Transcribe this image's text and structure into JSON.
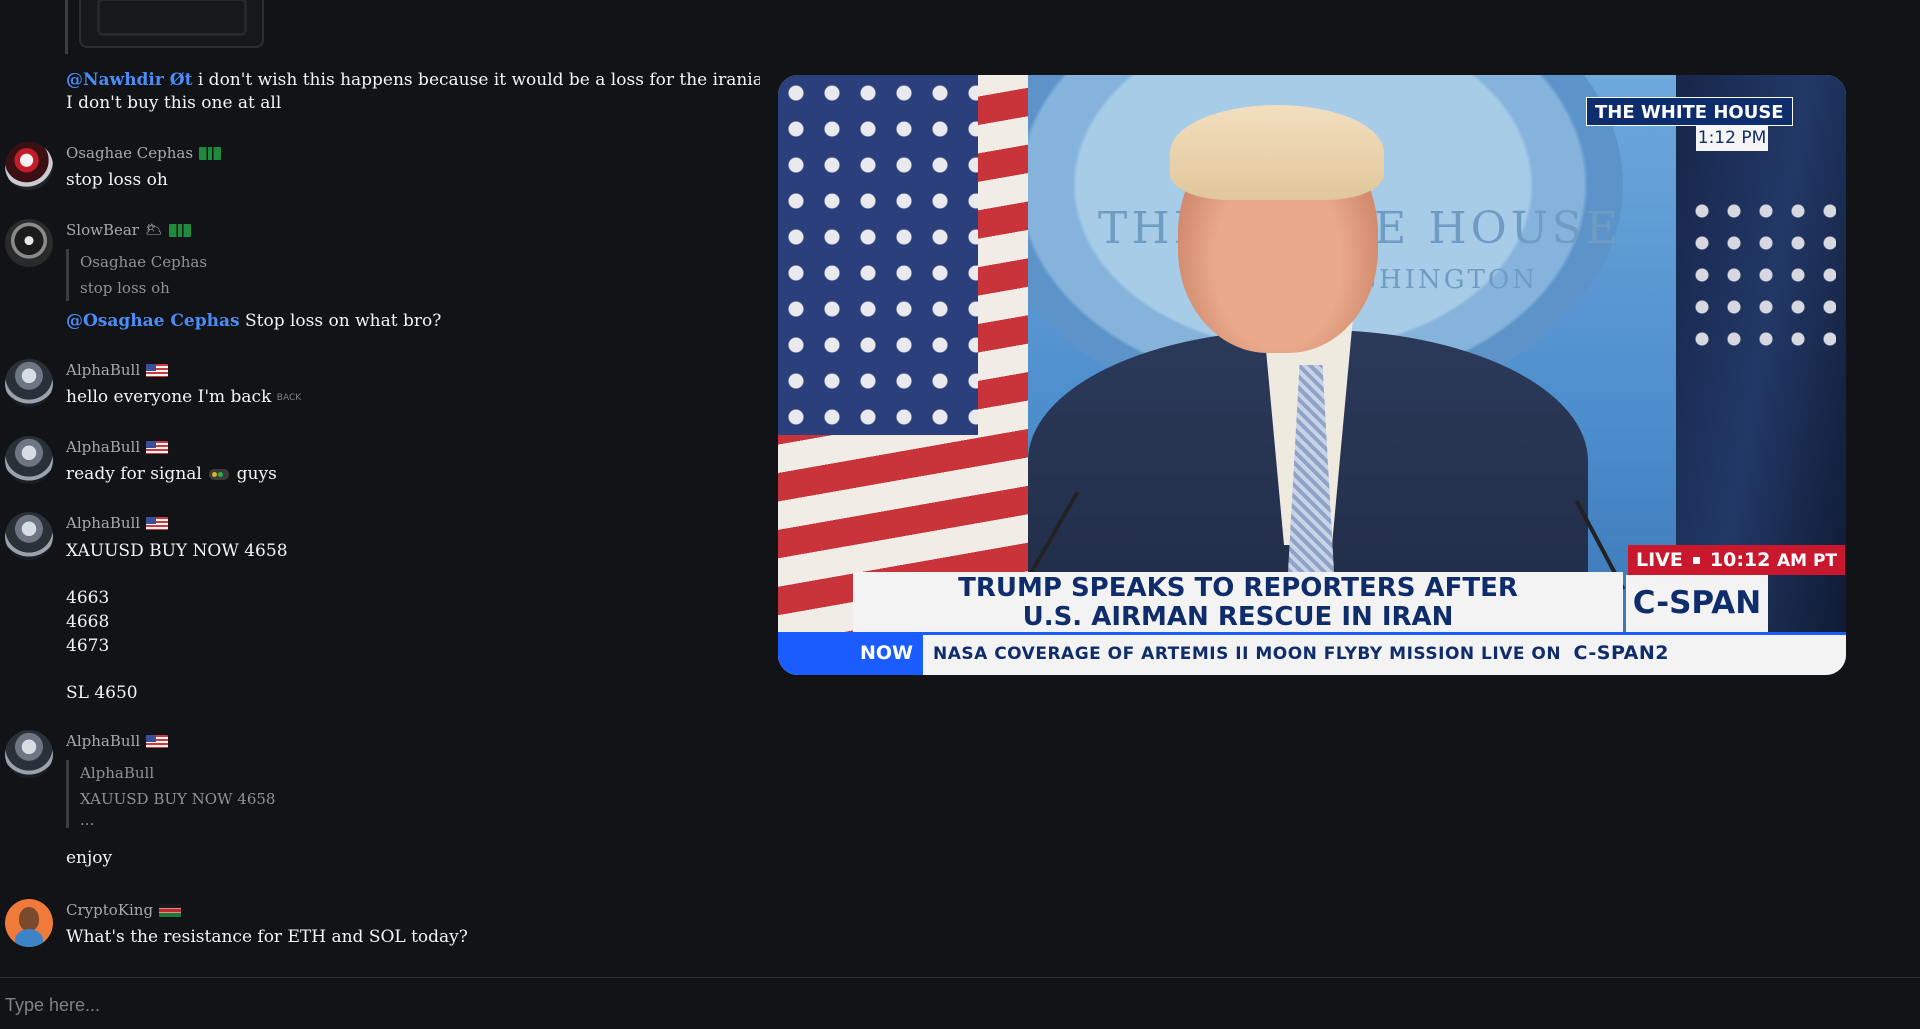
{
  "chat": {
    "messages": [
      {
        "mention": "@Nawhdir Øt",
        "text": "i don't wish this happens because it would be a loss for the iranian people .",
        "text2": "I don't buy this one at all"
      },
      {
        "username": "Osaghae Cephas",
        "text": "stop loss oh"
      },
      {
        "username": "SlowBear",
        "emoji": "🌥",
        "quote_user": "Osaghae Cephas",
        "quote_text": "stop loss oh",
        "mention": "@Osaghae Cephas",
        "text": "Stop loss on what bro?"
      },
      {
        "username": "AlphaBull",
        "text": "hello everyone I'm back",
        "icon_label": "BACK"
      },
      {
        "username": "AlphaBull",
        "text_before": "ready for signal",
        "text_after": "guys"
      },
      {
        "username": "AlphaBull",
        "lines": [
          "XAUUSD BUY NOW 4658",
          "4663",
          "4668",
          "4673",
          "SL 4650"
        ]
      },
      {
        "username": "AlphaBull",
        "quote_user": "AlphaBull",
        "quote_text": "XAUUSD BUY NOW 4658",
        "quote_more": "...",
        "text": "enjoy"
      },
      {
        "username": "CryptoKing",
        "text": "What's the resistance for ETH and SOL today?"
      }
    ]
  },
  "composer": {
    "placeholder": "Type here..."
  },
  "video": {
    "network_badge": "THE WHITE HOUSE",
    "local_time": "1:12 PM",
    "live_label": "LIVE",
    "live_time": "10:12",
    "live_time_suffix": "AM PT",
    "headline_line1": "TRUMP SPEAKS TO REPORTERS AFTER",
    "headline_line2": "U.S. AIRMAN RESCUE IN IRAN",
    "channel_logo": "C-SPAN",
    "ticker_label": "NOW",
    "ticker_text": "NASA COVERAGE OF ARTEMIS II MOON FLYBY MISSION  LIVE ON",
    "ticker_logo": "C-SPAN2",
    "backdrop_text": "THE WHITE HOUSE",
    "backdrop_text2": "WASHINGTON"
  }
}
